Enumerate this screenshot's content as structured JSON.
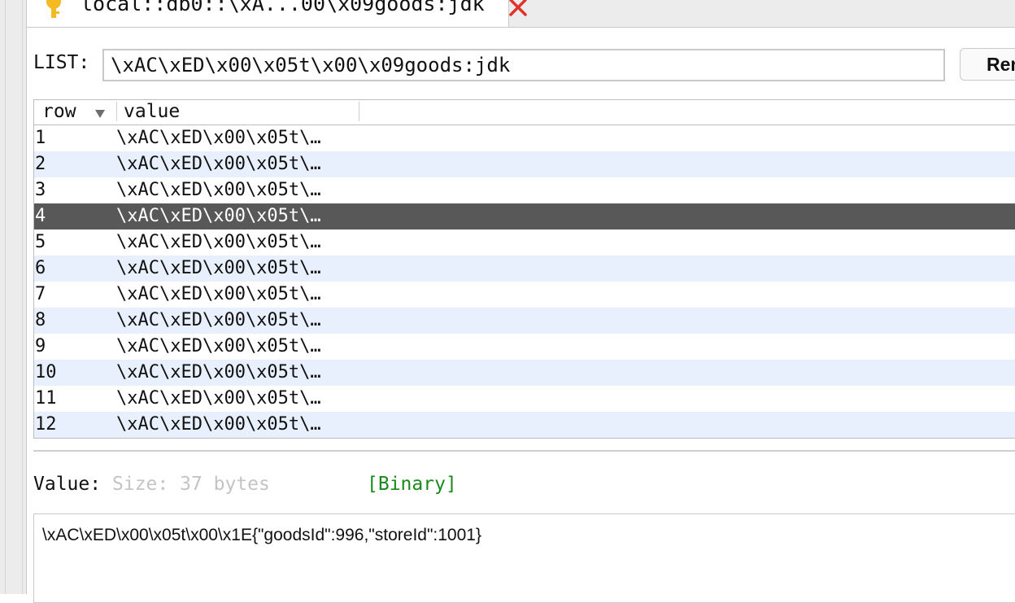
{
  "tab": {
    "title": "local::db0::\\xA...00\\x09goods:jdk",
    "key_icon": "key-icon",
    "close_icon": "close-icon",
    "key_color": "#f5b921",
    "close_color": "#e0322b"
  },
  "list": {
    "label": "LIST:",
    "key_value": "\\xAC\\xED\\x00\\x05t\\x00\\x09goods:jdk",
    "rename_label": "Ren"
  },
  "table": {
    "columns": [
      "row",
      "value"
    ],
    "sort_icon": "sort-descending-icon",
    "selected_row": "4",
    "rows": [
      {
        "row": "1",
        "value": "\\xAC\\xED\\x00\\x05t\\…"
      },
      {
        "row": "2",
        "value": "\\xAC\\xED\\x00\\x05t\\…"
      },
      {
        "row": "3",
        "value": "\\xAC\\xED\\x00\\x05t\\…"
      },
      {
        "row": "4",
        "value": "\\xAC\\xED\\x00\\x05t\\…"
      },
      {
        "row": "5",
        "value": "\\xAC\\xED\\x00\\x05t\\…"
      },
      {
        "row": "6",
        "value": "\\xAC\\xED\\x00\\x05t\\…"
      },
      {
        "row": "7",
        "value": "\\xAC\\xED\\x00\\x05t\\…"
      },
      {
        "row": "8",
        "value": "\\xAC\\xED\\x00\\x05t\\…"
      },
      {
        "row": "9",
        "value": "\\xAC\\xED\\x00\\x05t\\…"
      },
      {
        "row": "10",
        "value": "\\xAC\\xED\\x00\\x05t\\…"
      },
      {
        "row": "11",
        "value": "\\xAC\\xED\\x00\\x05t\\…"
      },
      {
        "row": "12",
        "value": "\\xAC\\xED\\x00\\x05t\\…"
      }
    ],
    "selected_color": "#585858",
    "alt_row_color": "#e9f0fd"
  },
  "value_panel": {
    "label": "Value:",
    "size_text": "Size: 37 bytes",
    "format": "[Binary]",
    "format_color": "#1a8a1a",
    "content": "\\xAC\\xED\\x00\\x05t\\x00\\x1E{\"goodsId\":996,\"storeId\":1001}"
  }
}
